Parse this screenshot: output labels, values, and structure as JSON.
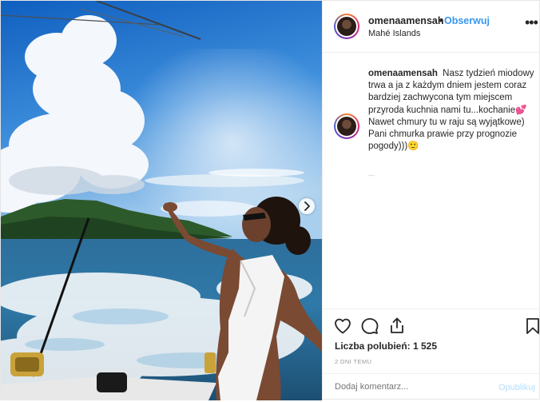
{
  "post": {
    "username": "omenaamensah",
    "follow_label": "Obserwuj",
    "separator": "•",
    "location": "Mahé Islands",
    "more_label": "•••",
    "caption": {
      "username": "omenaamensah",
      "text": "Nasz tydzień miodowy trwa a ja z każdym dniem jestem coraz bardziej zachwycona tym miejscem przyroda kuchnia nami tu...kochanie💕\nNawet chmury tu w raju są wyjątkowe) Pani chmurka prawie przy prognozie pogody)))🙂"
    },
    "likes_label": "Liczba polubień: 1 525",
    "time_label": "2 DNI TEMU",
    "comment_placeholder": "Dodaj komentarz...",
    "publish_label": "Opublikuj"
  },
  "icons": {
    "like": "heart-icon",
    "comment": "comment-icon",
    "share": "share-icon",
    "save": "bookmark-icon",
    "next": "chevron-right-icon",
    "more": "more-options-icon"
  },
  "colors": {
    "link_blue": "#3897f0",
    "publish_disabled": "#b2dffc",
    "text": "#262626",
    "border": "#efefef"
  }
}
